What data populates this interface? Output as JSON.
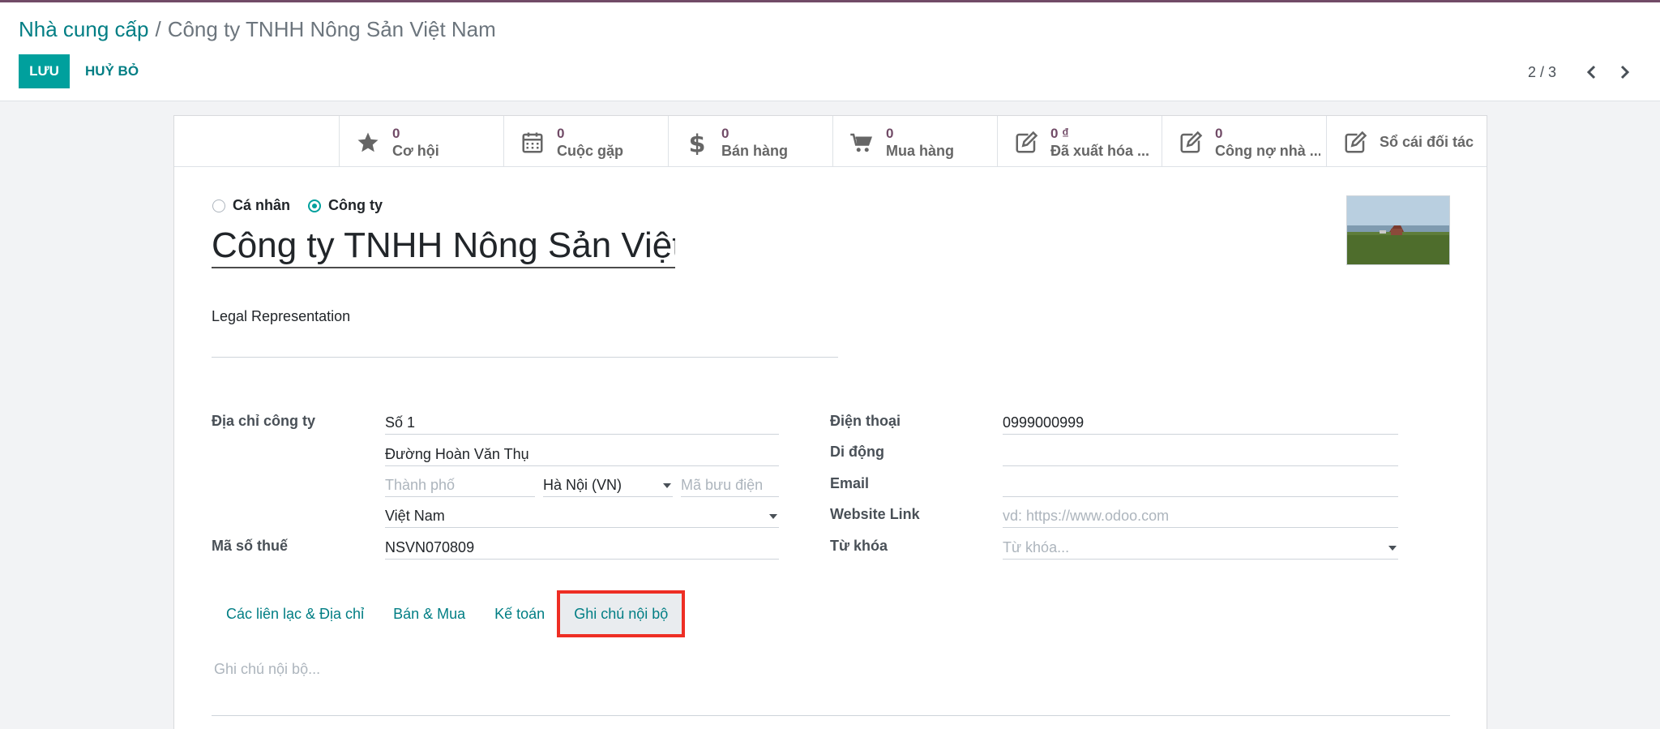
{
  "breadcrumb": {
    "parent": "Nhà cung cấp",
    "separator": "/",
    "current": "Công ty TNHH Nông Sản Việt Nam"
  },
  "toolbar": {
    "save_label": "LƯU",
    "discard_label": "HUỶ BỎ"
  },
  "pager": {
    "value": "2 / 3"
  },
  "smart_buttons": [
    {
      "icon": "star-icon",
      "value": "0",
      "label": "Cơ hội"
    },
    {
      "icon": "calendar-icon",
      "value": "0",
      "label": "Cuộc gặp"
    },
    {
      "icon": "dollar-icon",
      "value": "0",
      "label": "Bán hàng"
    },
    {
      "icon": "cart-icon",
      "value": "0",
      "label": "Mua hàng"
    },
    {
      "icon": "edit-icon",
      "value": "0 ₫",
      "label": "Đã xuất hóa ..."
    },
    {
      "icon": "edit-icon",
      "value": "0",
      "label": "Công nợ nhà ..."
    },
    {
      "icon": "edit-icon",
      "value": "",
      "label": "Sổ cái đối tác"
    }
  ],
  "company_type": {
    "individual": "Cá nhân",
    "company": "Công ty",
    "selected": "company"
  },
  "partner_name": "Công ty TNHH Nông Sản Việt",
  "legal_label": "Legal Representation",
  "address": {
    "label": "Địa chỉ công ty",
    "street": "Số 1",
    "street2": "Đường Hoàn Văn Thụ",
    "city_placeholder": "Thành phố",
    "state": "Hà Nội (VN)",
    "zip_placeholder": "Mã bưu điện",
    "country": "Việt Nam"
  },
  "tax": {
    "label": "Mã số thuế",
    "value": "NSVN070809"
  },
  "contact": {
    "phone_label": "Điện thoại",
    "phone": "0999000999",
    "mobile_label": "Di động",
    "email_label": "Email",
    "website_label": "Website Link",
    "website_placeholder": "vd: https://www.odoo.com",
    "tags_label": "Từ khóa",
    "tags_placeholder": "Từ khóa..."
  },
  "tabs": [
    {
      "label": "Các liên lạc & Địa chỉ",
      "active": false
    },
    {
      "label": "Bán & Mua",
      "active": false
    },
    {
      "label": "Kế toán",
      "active": false
    },
    {
      "label": "Ghi chú nội bộ",
      "active": true
    }
  ],
  "internal_note_placeholder": "Ghi chú nội bộ...",
  "colors": {
    "accent": "#00a09d",
    "brand": "#714b67",
    "link": "#017e84",
    "highlight": "#ee2e24"
  }
}
